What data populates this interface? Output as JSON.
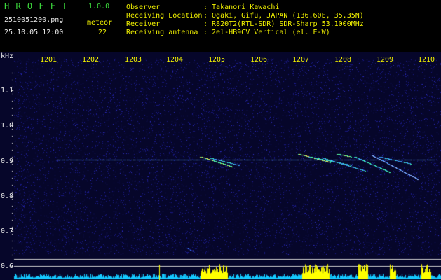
{
  "header": {
    "app_name": "H R O F F T",
    "version": "1.0.0",
    "filename": "2510051200.png",
    "datetime": "25.10.05 12:00",
    "meteor_label": "meteor",
    "meteor_count": "22",
    "info_labels": [
      "Observer",
      "Receiving Location",
      "Receiver",
      "Receiving antenna"
    ],
    "info_values": [
      ": Takanori Kawachi",
      ": Ogaki, Gifu, JAPAN (136.60E, 35.35N)",
      ": R820T2(RTL-SDR) SDR-Sharp 53.1000MHz",
      ": 2el-HB9CV Vertical (el. E-W)"
    ]
  },
  "plot": {
    "y_unit": "kHz",
    "y_ticks": [
      "1.1",
      "1.0",
      "0.9",
      "0.8",
      "0.7",
      "0.6"
    ],
    "x_ticks": [
      "1201",
      "1202",
      "1203",
      "1204",
      "1205",
      "1206",
      "1207",
      "1208",
      "1209",
      "1210"
    ],
    "colors": {
      "background": "#06062a",
      "noise": "#1a1a8a",
      "carrier": "#3a8cff",
      "echo_hot": "#ffe24a",
      "echo_mid": "#3dffb0",
      "histogram_base": "#14c8ff",
      "histogram_peak": "#ffff00"
    }
  }
}
